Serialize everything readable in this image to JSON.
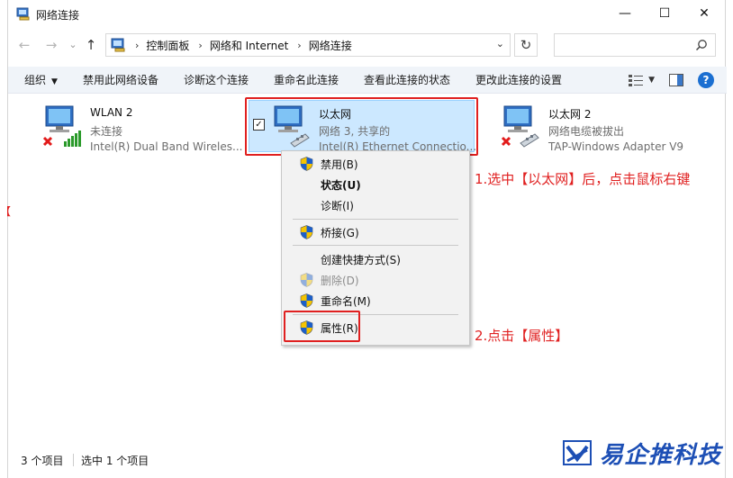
{
  "window": {
    "title": "网络连接"
  },
  "controls": {
    "minimize": "—",
    "maximize": "☐",
    "close": "✕"
  },
  "nav": {
    "back": "←",
    "forward": "→",
    "recent": "⌄",
    "up": "↑"
  },
  "address": {
    "crumbs": [
      "控制面板",
      "网络和 Internet",
      "网络连接"
    ],
    "separator": "›",
    "dropdown": "⌄",
    "refresh": "↻"
  },
  "search": {
    "placeholder": "",
    "icon": "search-icon"
  },
  "toolbar": {
    "items": [
      "组织",
      "禁用此网络设备",
      "诊断这个连接",
      "重命名此连接",
      "查看此连接的状态",
      "更改此连接的设置"
    ],
    "organize_caret": "▼",
    "view_caret": "▼",
    "help": "?"
  },
  "adapters": [
    {
      "name": "WLAN 2",
      "status": "未连接",
      "device": "Intel(R) Dual Band Wireles..."
    },
    {
      "name": "以太网",
      "status": "网络 3, 共享的",
      "device": "Intel(R) Ethernet Connectio..."
    },
    {
      "name": "以太网 2",
      "status": "网络电缆被拔出",
      "device": "TAP-Windows Adapter V9"
    }
  ],
  "selection": {
    "checkmark": "✓"
  },
  "context_menu": {
    "items": [
      "禁用(B)",
      "状态(U)",
      "诊断(I)",
      "桥接(G)",
      "创建快捷方式(S)",
      "删除(D)",
      "重命名(M)",
      "属性(R)"
    ]
  },
  "annotations": {
    "step1": "1.选中【以太网】后，点击鼠标右键",
    "step2": "2.点击【属性】",
    "left_mark": "【"
  },
  "statusbar": {
    "count": "3 个项目",
    "selected": "选中 1 个项目"
  },
  "watermark": {
    "text": "易企推科技"
  },
  "colors": {
    "accent": "#1b6fd1",
    "annotation": "#e02020",
    "selection": "#cce8ff"
  }
}
